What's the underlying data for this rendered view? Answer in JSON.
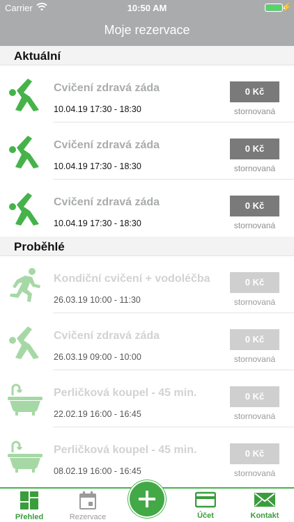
{
  "status_bar": {
    "carrier": "Carrier",
    "time": "10:50 AM"
  },
  "header": {
    "title": "Moje rezervace"
  },
  "sections": {
    "current": "Aktuální",
    "past": "Proběhlé"
  },
  "current_reservations": [
    {
      "icon": "stretching-person-icon",
      "title": "Cvičení zdravá záda",
      "dates": "10.04.19 17:30 - 18:30",
      "price": "0 Kč",
      "state": "stornovaná"
    },
    {
      "icon": "stretching-person-icon",
      "title": "Cvičení zdravá záda",
      "dates": "10.04.19 17:30 - 18:30",
      "price": "0 Kč",
      "state": "stornovaná"
    },
    {
      "icon": "stretching-person-icon",
      "title": "Cvičení zdravá záda",
      "dates": "10.04.19 17:30 - 18:30",
      "price": "0 Kč",
      "state": "stornovaná"
    }
  ],
  "past_reservations": [
    {
      "icon": "running-person-icon",
      "title": "Kondiční cvičení + vodoléčba",
      "dates": "26.03.19 10:00 - 11:30",
      "price": "0 Kč",
      "state": "stornovaná"
    },
    {
      "icon": "stretching-person-icon",
      "title": "Cvičení zdravá záda",
      "dates": "26.03.19 09:00 - 10:00",
      "price": "0 Kč",
      "state": "stornovaná"
    },
    {
      "icon": "bathtub-icon",
      "title": "Perličková koupel - 45 min.",
      "dates": "22.02.19 16:00 - 16:45",
      "price": "0 Kč",
      "state": "stornovaná"
    },
    {
      "icon": "bathtub-icon",
      "title": "Perličková koupel - 45 min.",
      "dates": "08.02.19 16:00 - 16:45",
      "price": "0 Kč",
      "state": "stornovaná"
    }
  ],
  "tabbar": {
    "overview": "Přehled",
    "reservations": "Rezervace",
    "account": "Účet",
    "contact": "Kontakt"
  },
  "colors": {
    "brand_green": "#45b34a",
    "header_gray": "#a9abac",
    "price_badge": "#7a7a7a",
    "price_badge_past": "#cfcfcf"
  }
}
